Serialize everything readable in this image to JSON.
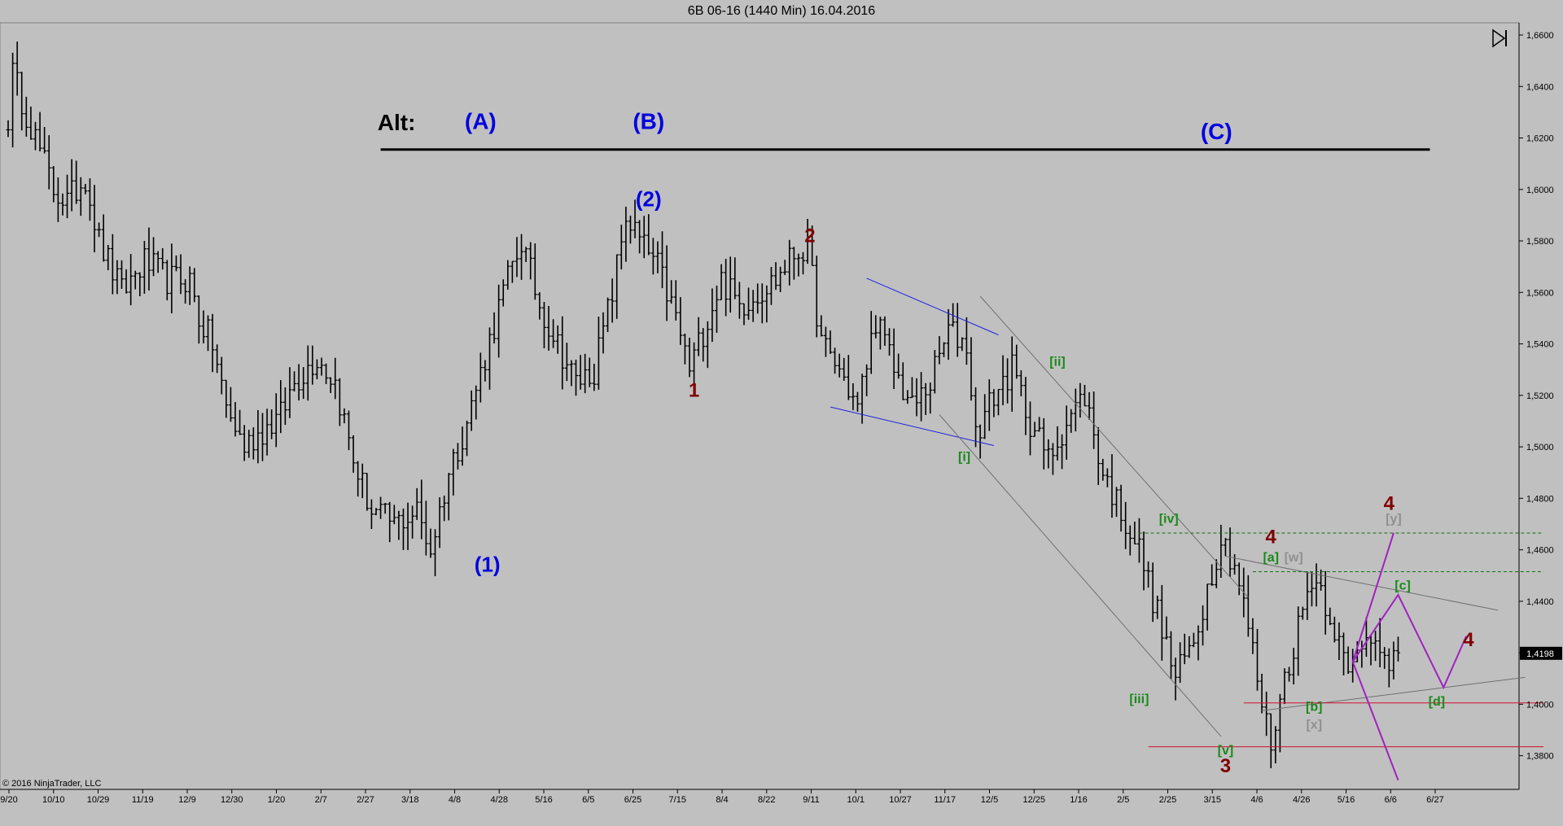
{
  "window": {
    "title": "6B 06-16 (1440 Min)  16.04.2016"
  },
  "copyright": "© 2016 NinjaTrader, LLC",
  "scroll_end_icon": "skip-to-end-icon",
  "colors": {
    "background": "#c0c0c0",
    "bar": "#000000",
    "degree_primary": "#0000e0",
    "degree_intermediate": "#800000",
    "degree_minor": "#1a8a1a",
    "degree_alt": "#909090",
    "projection": "#a020c0",
    "support": "#d01030",
    "resistance": "#107010"
  },
  "chart_data": {
    "type": "ohlc",
    "title": "6B 06-16 (1440 Min)  16.04.2016",
    "xlabel": "",
    "ylabel": "",
    "ylim": [
      1.37,
      1.66
    ],
    "y_ticks": [
      "1,6600",
      "1,6400",
      "1,6200",
      "1,6000",
      "1,5800",
      "1,5600",
      "1,5400",
      "1,5200",
      "1,5000",
      "1,4800",
      "1,4600",
      "1,4400",
      "1,4200",
      "1,4000",
      "1,3800"
    ],
    "y_tick_values": [
      1.66,
      1.64,
      1.62,
      1.6,
      1.58,
      1.56,
      1.54,
      1.52,
      1.5,
      1.48,
      1.46,
      1.44,
      1.42,
      1.4,
      1.38
    ],
    "x_ticks": [
      "9/20",
      "10/10",
      "10/29",
      "11/19",
      "12/9",
      "12/30",
      "1/20",
      "2/7",
      "2/27",
      "3/18",
      "4/8",
      "4/28",
      "5/16",
      "6/5",
      "6/25",
      "7/15",
      "8/4",
      "8/22",
      "9/11",
      "10/1",
      "10/27",
      "11/17",
      "12/5",
      "12/25",
      "1/16",
      "2/5",
      "2/25",
      "3/15",
      "4/6",
      "4/26",
      "5/16",
      "6/6",
      "6/27"
    ],
    "last_price": "1,4198",
    "last_price_value": 1.4198,
    "price_anchors": [
      [
        0,
        1.628
      ],
      [
        1,
        1.645
      ],
      [
        5,
        1.625
      ],
      [
        10,
        1.6
      ],
      [
        13,
        1.595
      ],
      [
        17,
        1.605
      ],
      [
        20,
        1.58
      ],
      [
        25,
        1.56
      ],
      [
        30,
        1.572
      ],
      [
        35,
        1.565
      ],
      [
        40,
        1.565
      ],
      [
        42,
        1.55
      ],
      [
        45,
        1.54
      ],
      [
        48,
        1.515
      ],
      [
        52,
        1.5
      ],
      [
        55,
        1.505
      ],
      [
        60,
        1.512
      ],
      [
        63,
        1.525
      ],
      [
        68,
        1.535
      ],
      [
        72,
        1.525
      ],
      [
        76,
        1.495
      ],
      [
        80,
        1.475
      ],
      [
        85,
        1.47
      ],
      [
        90,
        1.475
      ],
      [
        93,
        1.46
      ],
      [
        97,
        1.49
      ],
      [
        101,
        1.51
      ],
      [
        105,
        1.535
      ],
      [
        109,
        1.56
      ],
      [
        113,
        1.58
      ],
      [
        117,
        1.555
      ],
      [
        121,
        1.54
      ],
      [
        125,
        1.525
      ],
      [
        129,
        1.53
      ],
      [
        133,
        1.56
      ],
      [
        136,
        1.59
      ],
      [
        139,
        1.58
      ],
      [
        143,
        1.57
      ],
      [
        147,
        1.55
      ],
      [
        150,
        1.53
      ],
      [
        153,
        1.545
      ],
      [
        157,
        1.565
      ],
      [
        161,
        1.555
      ],
      [
        165,
        1.56
      ],
      [
        169,
        1.565
      ],
      [
        173,
        1.575
      ],
      [
        176,
        1.578
      ],
      [
        179,
        1.54
      ],
      [
        183,
        1.53
      ],
      [
        187,
        1.515
      ],
      [
        191,
        1.55
      ],
      [
        195,
        1.53
      ],
      [
        199,
        1.515
      ],
      [
        203,
        1.525
      ],
      [
        207,
        1.545
      ],
      [
        211,
        1.54
      ],
      [
        213,
        1.505
      ],
      [
        217,
        1.52
      ],
      [
        221,
        1.53
      ],
      [
        225,
        1.51
      ],
      [
        229,
        1.495
      ],
      [
        233,
        1.51
      ],
      [
        237,
        1.52
      ],
      [
        241,
        1.49
      ],
      [
        245,
        1.475
      ],
      [
        249,
        1.46
      ],
      [
        253,
        1.435
      ],
      [
        257,
        1.41
      ],
      [
        261,
        1.425
      ],
      [
        264,
        1.445
      ],
      [
        267,
        1.465
      ],
      [
        270,
        1.455
      ],
      [
        273,
        1.43
      ],
      [
        276,
        1.4
      ],
      [
        278,
        1.385
      ],
      [
        281,
        1.41
      ],
      [
        284,
        1.43
      ],
      [
        287,
        1.45
      ],
      [
        289,
        1.445
      ],
      [
        292,
        1.43
      ],
      [
        295,
        1.41
      ],
      [
        298,
        1.425
      ],
      [
        301,
        1.43
      ],
      [
        304,
        1.41
      ],
      [
        306,
        1.42
      ]
    ],
    "trendlines": [
      {
        "name": "alt-baseline",
        "points": [
          [
            82,
            1.6155
          ],
          [
            313,
            1.6155
          ]
        ],
        "color": "#000000",
        "width": 3
      },
      {
        "name": "triangle-upper-blue",
        "points": [
          [
            189,
            1.5655
          ],
          [
            218,
            1.5435
          ]
        ],
        "color": "#2020e0",
        "width": 1
      },
      {
        "name": "triangle-lower-blue",
        "points": [
          [
            181,
            1.5155
          ],
          [
            217,
            1.5005
          ]
        ],
        "color": "#2020e0",
        "width": 1
      },
      {
        "name": "channel-upper",
        "points": [
          [
            214,
            1.5585
          ],
          [
            273,
            1.4415
          ]
        ],
        "color": "#707070",
        "width": 1
      },
      {
        "name": "channel-lower",
        "points": [
          [
            205,
            1.5125
          ],
          [
            267,
            1.3875
          ]
        ],
        "color": "#707070",
        "width": 1
      },
      {
        "name": "triangle-upper-grey",
        "points": [
          [
            268,
            1.4575
          ],
          [
            328,
            1.4365
          ]
        ],
        "color": "#707070",
        "width": 1
      },
      {
        "name": "triangle-lower-grey",
        "points": [
          [
            276,
            1.3975
          ],
          [
            334,
            1.4105
          ]
        ],
        "color": "#707070",
        "width": 1
      },
      {
        "name": "resistance-1",
        "points": [
          [
            249,
            1.4665
          ],
          [
            338,
            1.4665
          ]
        ],
        "color": "#107010",
        "width": 1,
        "dash": "4,3"
      },
      {
        "name": "resistance-2",
        "points": [
          [
            274,
            1.4515
          ],
          [
            338,
            1.4515
          ]
        ],
        "color": "#107010",
        "width": 1,
        "dash": "4,3"
      },
      {
        "name": "support-1",
        "points": [
          [
            272,
            1.4005
          ],
          [
            338,
            1.4005
          ]
        ],
        "color": "#d01030",
        "width": 1
      },
      {
        "name": "support-2",
        "points": [
          [
            251,
            1.3835
          ],
          [
            338,
            1.3835
          ]
        ],
        "color": "#d01030",
        "width": 1
      },
      {
        "name": "projection-up",
        "points": [
          [
            296,
            1.4165
          ],
          [
            305,
            1.4665
          ]
        ],
        "color": "#a020c0",
        "width": 2
      },
      {
        "name": "projection-down",
        "points": [
          [
            296,
            1.4165
          ],
          [
            306,
            1.3705
          ]
        ],
        "color": "#a020c0",
        "width": 2
      },
      {
        "name": "projection-triangle",
        "points": [
          [
            296,
            1.4165
          ],
          [
            306,
            1.4425
          ],
          [
            316,
            1.4065
          ],
          [
            321,
            1.4265
          ]
        ],
        "color": "#a020c0",
        "width": 2
      }
    ],
    "annotations": [
      {
        "text": "Alt:",
        "i": 85.5,
        "y": 1.623,
        "color": "#000000",
        "size": 28
      },
      {
        "text": "(A)",
        "i": 104,
        "y": 1.6235,
        "color": "#0000e0",
        "size": 28
      },
      {
        "text": "(B)",
        "i": 141,
        "y": 1.6235,
        "color": "#0000e0",
        "size": 28
      },
      {
        "text": "(C)",
        "i": 266,
        "y": 1.6195,
        "color": "#0000e0",
        "size": 28
      },
      {
        "text": "(2)",
        "i": 141,
        "y": 1.5935,
        "color": "#0000e0",
        "size": 26
      },
      {
        "text": "(1)",
        "i": 105.5,
        "y": 1.4515,
        "color": "#0000e0",
        "size": 26
      },
      {
        "text": "2",
        "i": 176.5,
        "y": 1.5795,
        "color": "#800000",
        "size": 24
      },
      {
        "text": "1",
        "i": 151,
        "y": 1.5195,
        "color": "#800000",
        "size": 24
      },
      {
        "text": "3",
        "i": 268,
        "y": 1.3735,
        "color": "#800000",
        "size": 24
      },
      {
        "text": "4",
        "i": 278,
        "y": 1.4625,
        "color": "#800000",
        "size": 24
      },
      {
        "text": "4",
        "i": 304,
        "y": 1.4755,
        "color": "#800000",
        "size": 24
      },
      {
        "text": "4",
        "i": 321.5,
        "y": 1.4225,
        "color": "#800000",
        "size": 24
      },
      {
        "text": "[ii]",
        "i": 231,
        "y": 1.5315,
        "color": "#1a8a1a",
        "size": 16
      },
      {
        "text": "[i]",
        "i": 210.5,
        "y": 1.4945,
        "color": "#1a8a1a",
        "size": 16
      },
      {
        "text": "[iv]",
        "i": 255.5,
        "y": 1.4705,
        "color": "#1a8a1a",
        "size": 16
      },
      {
        "text": "[iii]",
        "i": 249,
        "y": 1.4005,
        "color": "#1a8a1a",
        "size": 16
      },
      {
        "text": "[v]",
        "i": 268,
        "y": 1.3805,
        "color": "#1a8a1a",
        "size": 16
      },
      {
        "text": "[a]",
        "i": 278,
        "y": 1.4555,
        "color": "#1a8a1a",
        "size": 16
      },
      {
        "text": "[w]",
        "i": 283,
        "y": 1.4555,
        "color": "#909090",
        "size": 16
      },
      {
        "text": "[b]",
        "i": 287.5,
        "y": 1.3975,
        "color": "#1a8a1a",
        "size": 16
      },
      {
        "text": "[x]",
        "i": 287.5,
        "y": 1.3905,
        "color": "#909090",
        "size": 16
      },
      {
        "text": "[y]",
        "i": 305,
        "y": 1.4705,
        "color": "#909090",
        "size": 16
      },
      {
        "text": "[c]",
        "i": 307,
        "y": 1.4445,
        "color": "#1a8a1a",
        "size": 16
      },
      {
        "text": "[d]",
        "i": 314.5,
        "y": 1.3995,
        "color": "#1a8a1a",
        "size": 16
      }
    ]
  }
}
